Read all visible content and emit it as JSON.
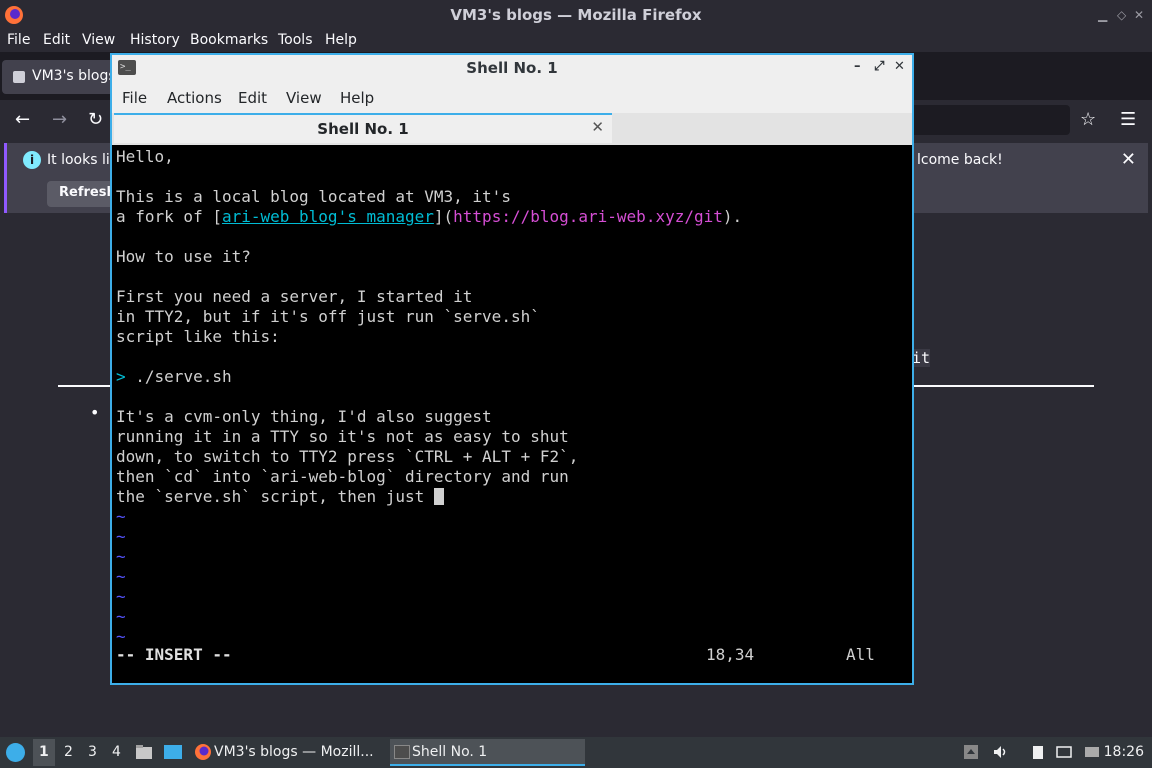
{
  "firefox": {
    "window_title": "VM3's blogs — Mozilla Firefox",
    "menu": [
      "File",
      "Edit",
      "View",
      "History",
      "Bookmarks",
      "Tools",
      "Help"
    ],
    "tab_title": "VM3's blogs",
    "notification": {
      "text_left": "It looks lik",
      "text_right": "lcome back!",
      "button": "Refresh"
    },
    "page_peek_text": "it"
  },
  "terminal": {
    "window_title": "Shell No. 1",
    "menu": [
      "File",
      "Actions",
      "Edit",
      "View",
      "Help"
    ],
    "tab_label": "Shell No. 1",
    "lines": [
      "Hello,",
      "",
      "This is a local blog located at VM3, it's",
      "",
      "",
      "How to use it?",
      "",
      "First you need a server, I started it",
      "in TTY2, but if it's off just run `serve.sh`",
      "script like this:",
      "",
      "",
      "",
      "It's a cvm-only thing, I'd also suggest",
      "running it in a TTY so it's not as easy to shut",
      "down, to switch to TTY2 press `CTRL + ALT + F2`,",
      "then `cd` into `ari-web-blog` directory and run",
      "the `serve.sh` script, then just "
    ],
    "fork_line": {
      "prefix": "a fork of [",
      "link_text": "ari-web blog's manager",
      "middle": "](",
      "url": "https://blog.ari-web.xyz/git",
      "suffix": ")."
    },
    "command_line": {
      "prompt": ">",
      "command": " ./serve.sh"
    },
    "tilde": "~",
    "status": {
      "mode": "-- INSERT --",
      "position": "18,34",
      "scroll": "All"
    }
  },
  "taskbar": {
    "workspaces": [
      "1",
      "2",
      "3",
      "4"
    ],
    "tasks": [
      "VM3's blogs — Mozill...",
      "Shell No. 1"
    ],
    "clock": "18:26"
  }
}
